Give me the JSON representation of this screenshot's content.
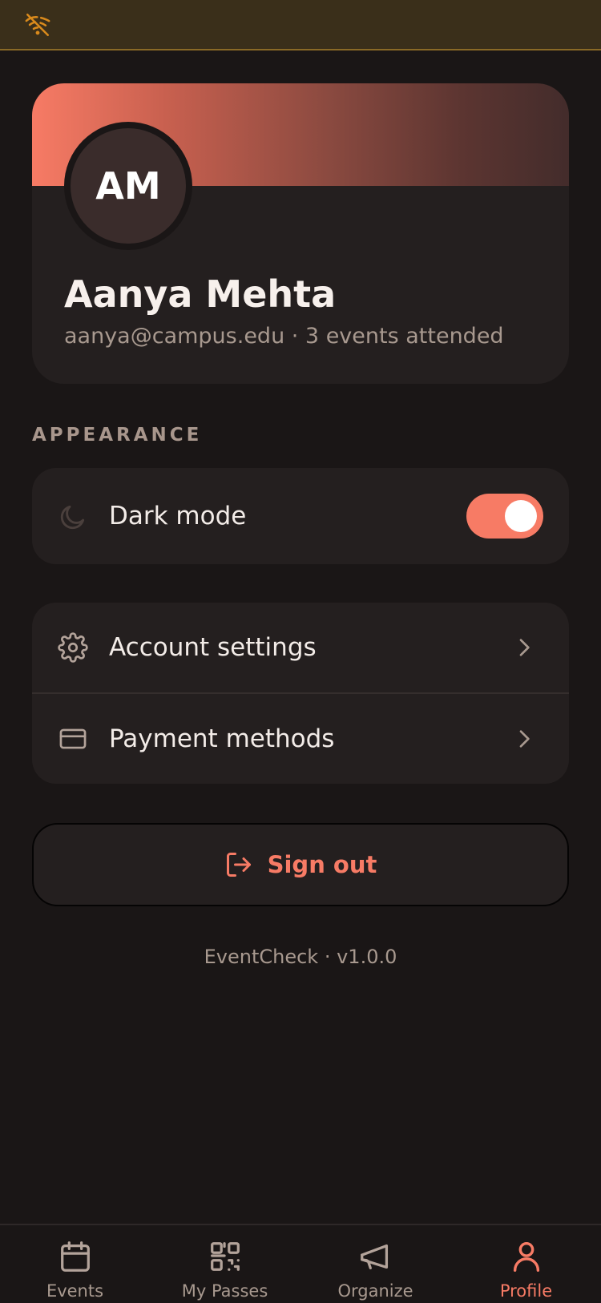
{
  "profile": {
    "initials": "AM",
    "name": "Aanya Mehta",
    "subtitle": "aanya@campus.edu · 3 events attended"
  },
  "appearance": {
    "section_label": "APPEARANCE",
    "dark_mode_label": "Dark mode",
    "dark_mode_on": true
  },
  "settings": {
    "items": [
      {
        "label": "Account settings",
        "icon": "gear-icon"
      },
      {
        "label": "Payment methods",
        "icon": "credit-card-icon"
      }
    ]
  },
  "signout": {
    "label": "Sign out",
    "icon": "sign-out-icon"
  },
  "version": "EventCheck · v1.0.0",
  "nav": {
    "items": [
      {
        "label": "Events",
        "icon": "calendar-icon"
      },
      {
        "label": "My Passes",
        "icon": "qr-code-icon"
      },
      {
        "label": "Organize",
        "icon": "megaphone-icon"
      },
      {
        "label": "Profile",
        "icon": "user-icon",
        "active": true
      }
    ]
  },
  "colors": {
    "accent": "#f77b65",
    "background": "#1a1616",
    "card": "#241f1f",
    "status_bar": "#3a2f1a"
  }
}
